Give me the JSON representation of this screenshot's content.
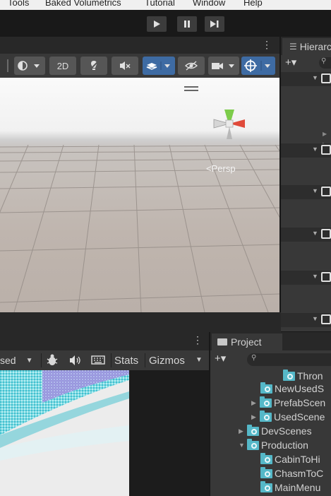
{
  "menubar": {
    "items": [
      "Tools",
      "Baked Volumetrics",
      "Tutorial",
      "Window",
      "Help"
    ]
  },
  "playbar": {
    "play_icon": "play-icon",
    "pause_icon": "pause-icon",
    "step_icon": "step-icon"
  },
  "scene": {
    "mode_2d": "2D",
    "persp_label": "<Persp",
    "icons": [
      "shading-mode-icon",
      "lighting-icon",
      "audio-mute-icon",
      "effects-icon",
      "visibility-icon",
      "camera-icon",
      "gizmo-toggle-icon"
    ]
  },
  "hierarchy": {
    "tab_label": "Hierarc",
    "add_label": "+▾"
  },
  "game": {
    "display_label": "sed",
    "stats_label": "Stats",
    "gizmos_label": "Gizmos"
  },
  "project": {
    "tab_label": "Project",
    "add_label": "+▾",
    "items": [
      {
        "label": "Thron",
        "indent": 5,
        "arrow": ""
      },
      {
        "label": "NewUsedS",
        "indent": 4,
        "arrow": ""
      },
      {
        "label": "PrefabScen",
        "indent": 4,
        "arrow": "▶"
      },
      {
        "label": "UsedScene",
        "indent": 4,
        "arrow": "▶"
      },
      {
        "label": "DevScenes",
        "indent": 3,
        "arrow": "▶"
      },
      {
        "label": "Production",
        "indent": 3,
        "arrow": "▼"
      },
      {
        "label": "CabinToHi",
        "indent": 4,
        "arrow": ""
      },
      {
        "label": "ChasmToC",
        "indent": 4,
        "arrow": ""
      },
      {
        "label": "MainMenu",
        "indent": 4,
        "arrow": ""
      }
    ]
  },
  "colors": {
    "accent": "#3e6ba3",
    "folder": "#55b8c8",
    "panel": "#383838",
    "dark": "#191919"
  }
}
